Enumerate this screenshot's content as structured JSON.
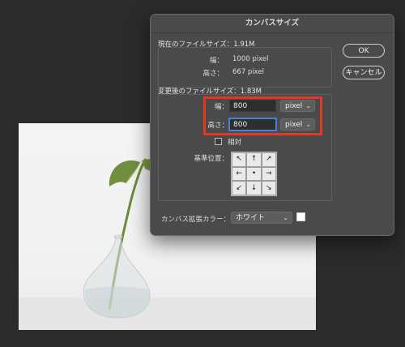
{
  "dialog": {
    "title": "カンバスサイズ",
    "current": {
      "header": "現在のファイルサイズ：1.91M",
      "width_label": "幅：",
      "width_value": "1000 pixel",
      "height_label": "高さ：",
      "height_value": "667 pixel"
    },
    "new": {
      "header": "変更後のファイルサイズ：1.83M",
      "width_label": "幅：",
      "width_value": "800",
      "width_unit": "pixel",
      "height_label": "高さ：",
      "height_value": "800",
      "height_unit": "pixel",
      "relative_label": "相対",
      "anchor_label": "基準位置："
    },
    "extension_color": {
      "label": "カンバス拡張カラー：",
      "value": "ホワイト",
      "swatch_color": "#ffffff"
    },
    "buttons": {
      "ok": "OK",
      "cancel": "キャンセル"
    }
  },
  "anchor_icons": [
    "arrow-up-left",
    "arrow-up",
    "arrow-up-right",
    "arrow-left",
    "dot",
    "arrow-right",
    "arrow-down-left",
    "arrow-down",
    "arrow-down-right"
  ],
  "anchor_glyphs": [
    "↖",
    "↑",
    "↗",
    "←",
    "•",
    "→",
    "↙",
    "↓",
    "↘"
  ],
  "highlight_color": "#e53626"
}
